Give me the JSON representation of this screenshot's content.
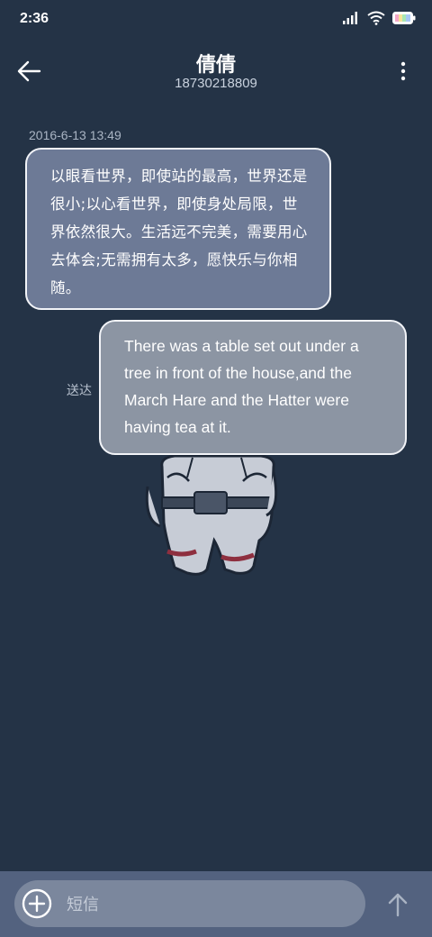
{
  "status_bar": {
    "time": "2:36",
    "icons": [
      "signal-icon",
      "wifi-icon",
      "battery-icon"
    ]
  },
  "header": {
    "back_icon": "arrow-left-icon",
    "contact_name": "倩倩",
    "phone_number": "18730218809",
    "more_icon": "more-vertical-icon"
  },
  "conversation": {
    "timestamp": "2016-6-13 13:49",
    "incoming_message": "以眼看世界，即使站的最高，世界还是很小;以心看世界，即使身处局限，世界依然很大。生活远不完美，需要用心去体会;无需拥有太多，愿快乐与你相随。",
    "outgoing_message": "There was a table set out under a tree in front of the house,and the March Hare and the Hatter were having tea at it.",
    "delivery_status": "送达"
  },
  "composer": {
    "add_icon": "plus-circle-icon",
    "placeholder": "短信",
    "value": "",
    "send_icon": "arrow-up-icon"
  },
  "colors": {
    "background": "#243346",
    "incoming_bubble": "#6d7a96",
    "outgoing_bubble": "#8c95a3",
    "bottom_bar": "#53627f",
    "input_pill": "#7b879d"
  }
}
